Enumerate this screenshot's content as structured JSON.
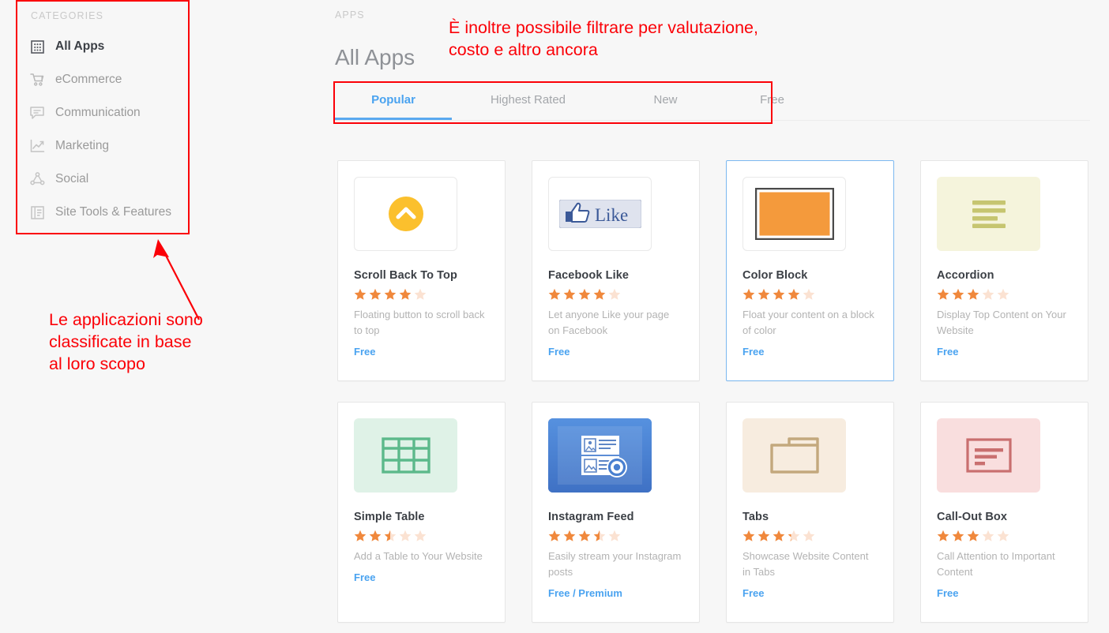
{
  "sidebar": {
    "heading": "CATEGORIES",
    "items": [
      {
        "label": "All Apps",
        "icon": "grid-icon",
        "active": true
      },
      {
        "label": "eCommerce",
        "icon": "shopping-cart-icon",
        "active": false
      },
      {
        "label": "Communication",
        "icon": "chat-bubble-icon",
        "active": false
      },
      {
        "label": "Marketing",
        "icon": "line-chart-icon",
        "active": false
      },
      {
        "label": "Social",
        "icon": "network-share-icon",
        "active": false
      },
      {
        "label": "Site Tools & Features",
        "icon": "layout-panel-icon",
        "active": false
      }
    ]
  },
  "header": {
    "eyebrow": "APPS",
    "title": "All Apps"
  },
  "tabs": [
    {
      "label": "Popular",
      "active": true
    },
    {
      "label": "Highest Rated",
      "active": false
    },
    {
      "label": "New",
      "active": false
    },
    {
      "label": "Free",
      "active": false
    }
  ],
  "annotations": {
    "top": "È inoltre possibile filtrare per valutazione,\ncosto e altro ancora",
    "left": "Le applicazioni sono\nclassificate in base\nal loro scopo",
    "color": "#fb0007"
  },
  "colors": {
    "accent_blue": "#4aa3f0",
    "star_on": "#f0883c",
    "star_off": "#fbe2d2",
    "page_bg": "#f7f7f7",
    "annotation_red": "#fb0007"
  },
  "cards": [
    {
      "title": "Scroll Back To Top",
      "rating": 4,
      "description": "Floating button to scroll back to top",
      "price": "Free",
      "icon": "scroll-to-top-icon",
      "selected": false
    },
    {
      "title": "Facebook Like",
      "rating": 4,
      "description": "Let anyone Like your page on Facebook",
      "price": "Free",
      "icon": "facebook-like-icon",
      "selected": false
    },
    {
      "title": "Color Block",
      "rating": 4,
      "description": "Float your content on a block of color",
      "price": "Free",
      "icon": "color-block-icon",
      "selected": true
    },
    {
      "title": "Accordion",
      "rating": 3,
      "description": "Display Top Content on Your Website",
      "price": "Free",
      "icon": "accordion-icon",
      "selected": false
    },
    {
      "title": "Simple Table",
      "rating": 2.5,
      "description": "Add a Table to Your Website",
      "price": "Free",
      "icon": "table-icon",
      "selected": false
    },
    {
      "title": "Instagram Feed",
      "rating": 3.5,
      "description": "Easily stream your Instagram posts",
      "price": "Free / Premium",
      "icon": "instagram-feed-icon",
      "selected": false
    },
    {
      "title": "Tabs",
      "rating": 3.25,
      "description": "Showcase Website Content in Tabs",
      "price": "Free",
      "icon": "tabs-icon",
      "selected": false
    },
    {
      "title": "Call-Out Box",
      "rating": 3,
      "description": "Call Attention to Important Content",
      "price": "Free",
      "icon": "call-out-box-icon",
      "selected": false
    }
  ]
}
